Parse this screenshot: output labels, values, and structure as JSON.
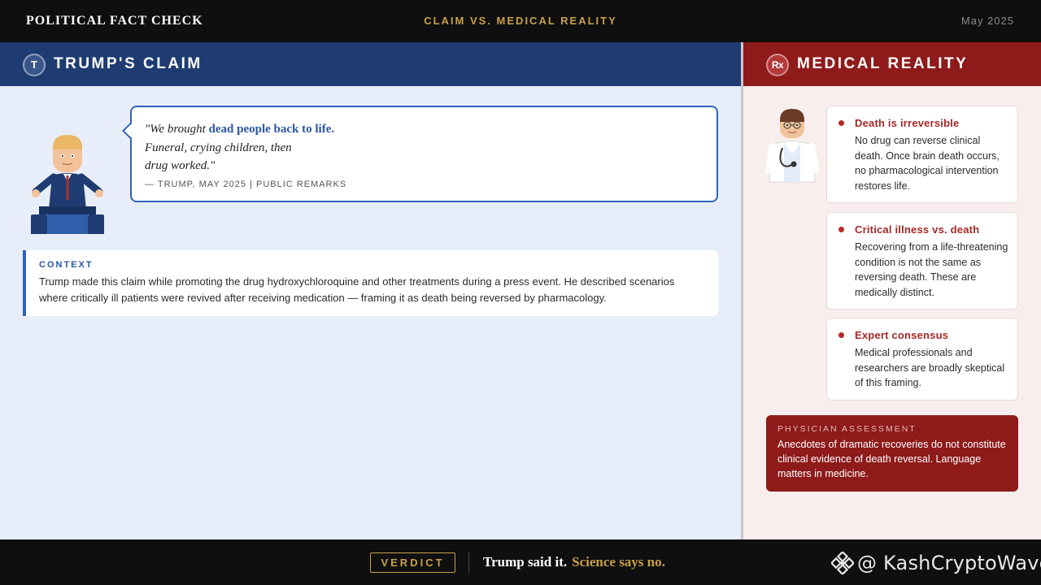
{
  "topbar": {
    "title": "POLITICAL FACT CHECK",
    "center": "CLAIM VS. MEDICAL REALITY",
    "date": "May 2025"
  },
  "left": {
    "badge": "T",
    "header": "TRUMP'S CLAIM",
    "quote": {
      "line1_a": "\"We brought ",
      "line1_b": "dead people back to life.",
      "line2": "Funeral, crying children, then",
      "line3": "drug worked.\""
    },
    "attribution": "— TRUMP, MAY 2025  |  PUBLIC REMARKS",
    "context": {
      "label": "CONTEXT",
      "text": "Trump made this claim while promoting the drug hydroxychloroquine and other treatments during a press event. He described scenarios where critically ill patients were revived after receiving medication — framing it as death being reversed by pharmacology."
    }
  },
  "right": {
    "badge": "Rx",
    "header": "MEDICAL REALITY",
    "cards": [
      {
        "title": "Death is irreversible",
        "text": "No drug can reverse clinical death. Once brain death occurs, no pharmacological intervention restores life."
      },
      {
        "title": "Critical illness vs. death",
        "text": "Recovering from a life-threatening condition is not the same as reversing death. These are medically distinct."
      },
      {
        "title": "Expert consensus",
        "text": "Medical professionals and researchers are broadly skeptical of this framing."
      }
    ],
    "assessment": {
      "label": "PHYSICIAN ASSESSMENT",
      "text": "Anecdotes of dramatic recoveries do not constitute clinical evidence of death reversal. Language matters in medicine."
    }
  },
  "bottom": {
    "verdict_label": "VERDICT",
    "verdict_white": "Trump said it.",
    "verdict_gold": "Science says no."
  },
  "watermark": {
    "text": "@ KashCryptoWave",
    "icon": "binance-logo-icon"
  },
  "colors": {
    "navy": "#1e3c72",
    "crimson": "#8e1a1a",
    "gold": "#c9a04a",
    "blue_accent": "#2f63b8"
  }
}
